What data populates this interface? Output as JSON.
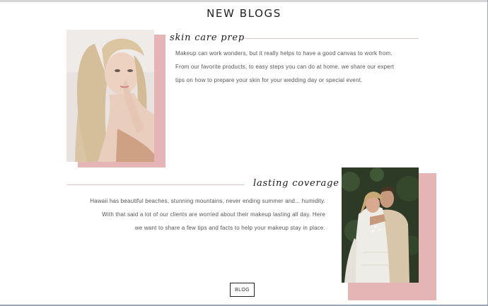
{
  "page": {
    "title": "NEW BLOGS"
  },
  "posts": [
    {
      "heading": "skin care prep",
      "lines": [
        "Makeup can work wonders, but it really helps to have a good canvas to work from.",
        "From our favorite products, to easy steps you can do at home, we share our expert",
        "tips on how to prepare your skin for your wedding day or special event."
      ]
    },
    {
      "heading": "lasting coverage",
      "lines": [
        "Hawaii has beautiful beaches, stunning mountains, never ending summer and... humidity.",
        "With that said a lot of our clients are worried about their makeup lasting all day. Here",
        "we want to share a few tips and facts to help your makeup stay in place."
      ]
    }
  ],
  "cta": {
    "label": "BLOG"
  },
  "colors": {
    "accent_pink": "#e5b5b6",
    "rule_pink": "#e2c7c8",
    "text": "#555555",
    "heading": "#1a1a1a"
  }
}
